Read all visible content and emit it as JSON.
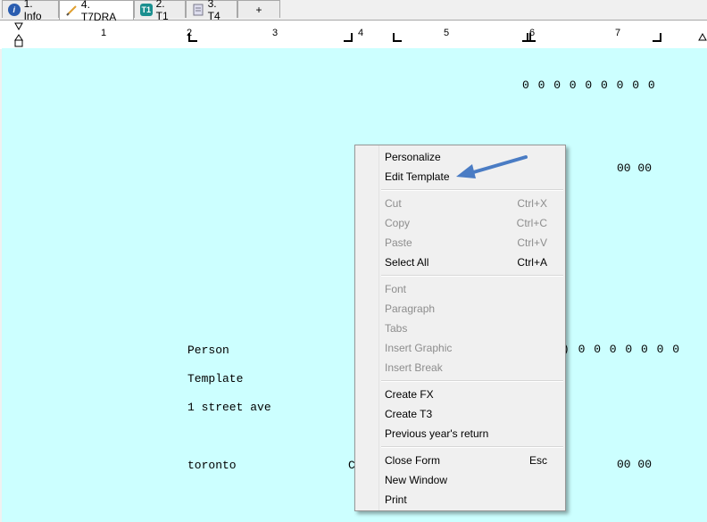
{
  "tabs": [
    {
      "label": "1. Info",
      "icon": "info-icon"
    },
    {
      "label": "4. T7DRA",
      "icon": "pencil-icon"
    },
    {
      "label": "2. T1",
      "icon": "t1-icon",
      "icon_text": "T1"
    },
    {
      "label": "3. T4",
      "icon": "form-icon"
    },
    {
      "label": "+",
      "icon": ""
    }
  ],
  "ruler": {
    "numbers": [
      "1",
      "2",
      "3",
      "4",
      "5",
      "6",
      "7"
    ]
  },
  "document": {
    "line_top": "0 0 0 0 0 0 0 0 0",
    "line_mid": "00 00",
    "name": "Person",
    "template": "Template",
    "address": "1 street ave",
    "city": "toronto",
    "city_partial": "C",
    "line_right": ") 0 0 0 0 0 0 0",
    "line_bottom": "00 00"
  },
  "context_menu": {
    "items": [
      {
        "label": "Personalize",
        "shortcut": "",
        "enabled": true
      },
      {
        "label": "Edit Template",
        "shortcut": "",
        "enabled": true
      },
      {
        "label": "Cut",
        "shortcut": "Ctrl+X",
        "enabled": false
      },
      {
        "label": "Copy",
        "shortcut": "Ctrl+C",
        "enabled": false
      },
      {
        "label": "Paste",
        "shortcut": "Ctrl+V",
        "enabled": false
      },
      {
        "label": "Select All",
        "shortcut": "Ctrl+A",
        "enabled": true
      },
      {
        "label": "Font",
        "shortcut": "",
        "enabled": false
      },
      {
        "label": "Paragraph",
        "shortcut": "",
        "enabled": false
      },
      {
        "label": "Tabs",
        "shortcut": "",
        "enabled": false
      },
      {
        "label": "Insert Graphic",
        "shortcut": "",
        "enabled": false
      },
      {
        "label": "Insert Break",
        "shortcut": "",
        "enabled": false
      },
      {
        "label": "Create FX",
        "shortcut": "",
        "enabled": true
      },
      {
        "label": "Create T3",
        "shortcut": "",
        "enabled": true
      },
      {
        "label": "Previous year's return",
        "shortcut": "",
        "enabled": true
      },
      {
        "label": "Close Form",
        "shortcut": "Esc",
        "enabled": true
      },
      {
        "label": "New Window",
        "shortcut": "",
        "enabled": true
      },
      {
        "label": "Print",
        "shortcut": "",
        "enabled": true
      }
    ]
  },
  "colors": {
    "document_bg": "#ccffff",
    "arrow": "#4a7cc4",
    "info_blue": "#2a5db0",
    "t1_teal": "#1a8f8f"
  }
}
